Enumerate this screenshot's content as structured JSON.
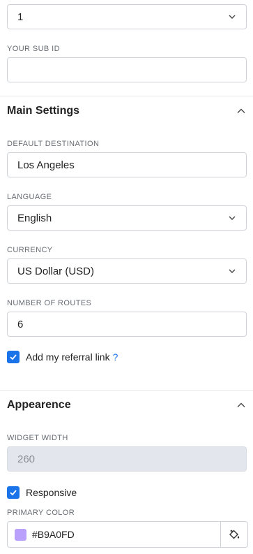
{
  "top_select": {
    "value": "1"
  },
  "sub_id": {
    "label": "YOUR SUB ID",
    "value": ""
  },
  "main_settings": {
    "title": "Main Settings",
    "default_destination": {
      "label": "DEFAULT DESTINATION",
      "value": "Los Angeles"
    },
    "language": {
      "label": "LANGUAGE",
      "value": "English"
    },
    "currency": {
      "label": "CURRENCY",
      "value": "US Dollar (USD)"
    },
    "number_of_routes": {
      "label": "NUMBER OF ROUTES",
      "value": "6"
    },
    "referral": {
      "label": "Add my referral link",
      "help": "?",
      "checked": true
    }
  },
  "appearance": {
    "title": "Appearence",
    "widget_width": {
      "label": "WIDGET WIDTH",
      "value": "260"
    },
    "responsive": {
      "label": "Responsive",
      "checked": true
    },
    "primary_color": {
      "label": "PRIMARY COLOR",
      "value": "#B9A0FD",
      "swatch": "#B9A0FD"
    }
  },
  "icons": {
    "dropdown": "chevron-down-icon",
    "collapse": "chevron-up-icon",
    "check": "checkmark-icon",
    "paint": "paint-bucket-icon"
  },
  "colors": {
    "accent": "#1a73e8",
    "border": "#cfd3d8",
    "disabled_bg": "#e3e6ec"
  }
}
